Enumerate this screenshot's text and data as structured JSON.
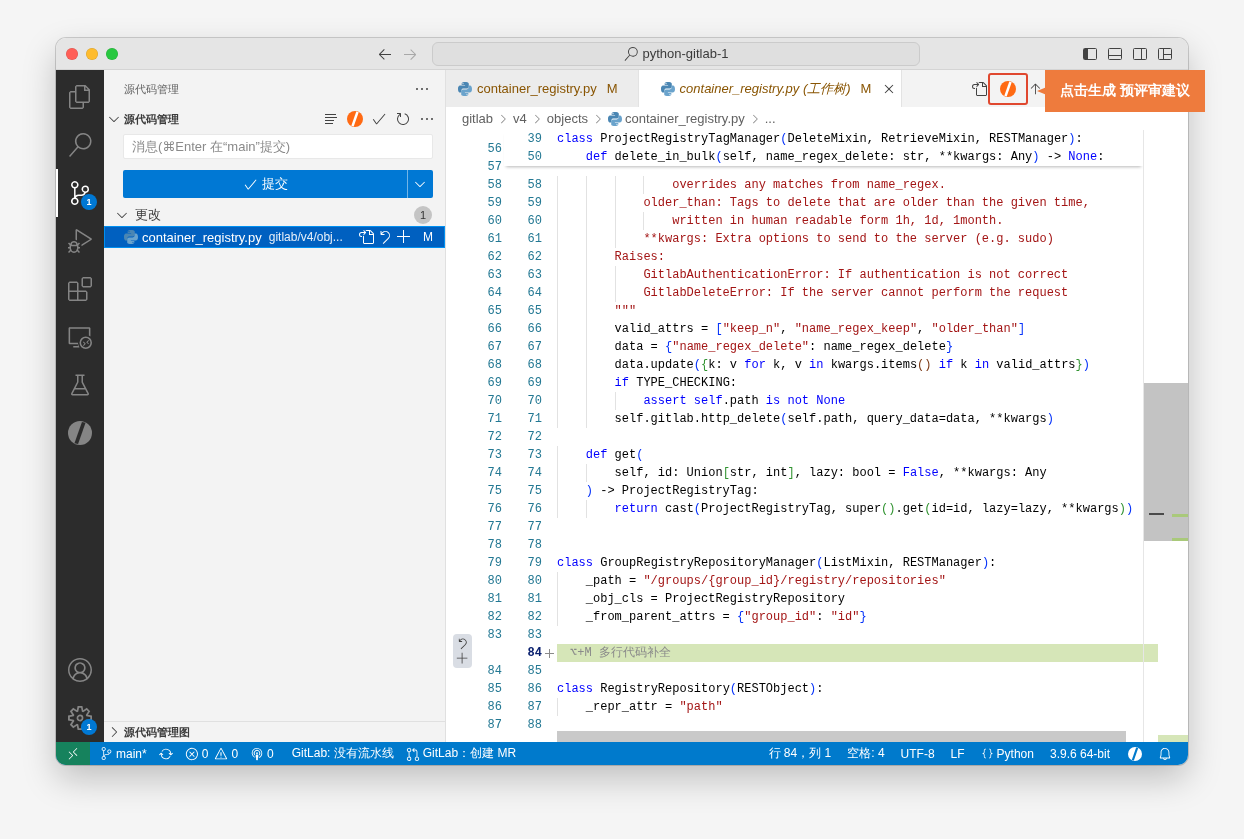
{
  "window": {
    "title": "python-gitlab-1",
    "can_go_back": true,
    "can_go_forward": false
  },
  "activity_bar": {
    "items": [
      {
        "kind": "explorer",
        "selected": false
      },
      {
        "kind": "search",
        "selected": false
      },
      {
        "kind": "source_control",
        "selected": true,
        "badge": "1"
      },
      {
        "kind": "run_debug",
        "selected": false
      },
      {
        "kind": "extensions",
        "selected": false
      },
      {
        "kind": "remote_explorer",
        "selected": false
      },
      {
        "kind": "testing",
        "selected": false
      },
      {
        "kind": "assistant",
        "selected": false
      }
    ],
    "bottom_items": [
      {
        "kind": "account"
      },
      {
        "kind": "settings",
        "badge": "1"
      }
    ]
  },
  "sidebar": {
    "title": "源代码管理",
    "section": {
      "title": "源代码管理",
      "expanded": true
    },
    "message_input": {
      "placeholder": "消息(⌘Enter 在“main”提交)"
    },
    "commit_button": {
      "label": "提交"
    },
    "changes": {
      "title": "更改",
      "expanded": true,
      "count": "1",
      "files": [
        {
          "name": "container_registry.py",
          "path": "gitlab/v4/obj...",
          "status": "M",
          "selected": true
        }
      ]
    },
    "graph_section": {
      "title": "源代码管理图",
      "expanded": false
    }
  },
  "tabs": [
    {
      "label": "container_registry.py",
      "status": "M",
      "selected": false,
      "preview": false
    },
    {
      "label": "container_registry.py (工作树)",
      "status": "M",
      "selected": true,
      "preview": true
    }
  ],
  "callout": {
    "text": "点击生成 预评审建议"
  },
  "breadcrumbs": [
    {
      "kind": "folder",
      "label": "gitlab"
    },
    {
      "kind": "folder",
      "label": "v4"
    },
    {
      "kind": "folder",
      "label": "objects"
    },
    {
      "kind": "file",
      "label": "container_registry.py"
    },
    {
      "kind": "symbol",
      "label": "..."
    }
  ],
  "editor": {
    "sticky_lines": [
      {
        "new": "39",
        "tokens": [
          {
            "kind": "keyword",
            "text": "class"
          },
          {
            "kind": "plain",
            "text": " ProjectRegistryTagManager"
          },
          {
            "kind": "bracket1",
            "text": "("
          },
          {
            "kind": "plain",
            "text": "DeleteMixin, RetrieveMixin, RESTManager"
          },
          {
            "kind": "bracket1",
            "text": ")"
          },
          {
            "kind": "plain",
            "text": ":"
          }
        ]
      },
      {
        "new": "50",
        "tokens": [
          {
            "kind": "keyword",
            "text": "    def"
          },
          {
            "kind": "plain",
            "text": " delete_in_bulk"
          },
          {
            "kind": "bracket1",
            "text": "("
          },
          {
            "kind": "plain",
            "text": "self, name_regex_delete: str, **kwargs: Any"
          },
          {
            "kind": "bracket1",
            "text": ")"
          },
          {
            "kind": "plain",
            "text": " -> "
          },
          {
            "kind": "keyword",
            "text": "None"
          },
          {
            "kind": "plain",
            "text": ":"
          }
        ]
      }
    ],
    "lines": [
      {
        "kind": "context",
        "old": "56",
        "current": false
      },
      {
        "kind": "context",
        "old": "57",
        "current": false
      },
      {
        "kind": "context",
        "old": "58",
        "new": "58",
        "current": false,
        "tokens": [
          {
            "kind": "string",
            "text": "                overrides any matches from name_regex."
          }
        ]
      },
      {
        "kind": "context",
        "old": "59",
        "new": "59",
        "current": false,
        "tokens": [
          {
            "kind": "string",
            "text": "            older_than: Tags to delete that are older than the given time,"
          }
        ]
      },
      {
        "kind": "context",
        "old": "60",
        "new": "60",
        "current": false,
        "tokens": [
          {
            "kind": "string",
            "text": "                written in human readable form 1h, 1d, 1month."
          }
        ]
      },
      {
        "kind": "context",
        "old": "61",
        "new": "61",
        "current": false,
        "tokens": [
          {
            "kind": "string",
            "text": "            **kwargs: Extra options to send to the server (e.g. sudo)"
          }
        ]
      },
      {
        "kind": "context",
        "old": "62",
        "new": "62",
        "current": false,
        "tokens": [
          {
            "kind": "string",
            "text": "        Raises:"
          }
        ]
      },
      {
        "kind": "context",
        "old": "63",
        "new": "63",
        "current": false,
        "tokens": [
          {
            "kind": "string",
            "text": "            GitlabAuthenticationError: If authentication is not correct"
          }
        ]
      },
      {
        "kind": "context",
        "old": "64",
        "new": "64",
        "current": false,
        "tokens": [
          {
            "kind": "string",
            "text": "            GitlabDeleteError: If the server cannot perform the request"
          }
        ]
      },
      {
        "kind": "context",
        "old": "65",
        "new": "65",
        "current": false,
        "tokens": [
          {
            "kind": "string",
            "text": "        \"\"\""
          }
        ]
      },
      {
        "kind": "context",
        "old": "66",
        "new": "66",
        "current": false,
        "tokens": [
          {
            "kind": "plain",
            "text": "        valid_attrs = "
          },
          {
            "kind": "bracket1",
            "text": "["
          },
          {
            "kind": "string",
            "text": "\"keep_n\""
          },
          {
            "kind": "plain",
            "text": ", "
          },
          {
            "kind": "string",
            "text": "\"name_regex_keep\""
          },
          {
            "kind": "plain",
            "text": ", "
          },
          {
            "kind": "string",
            "text": "\"older_than\""
          },
          {
            "kind": "bracket1",
            "text": "]"
          }
        ]
      },
      {
        "kind": "context",
        "old": "67",
        "new": "67",
        "current": false,
        "tokens": [
          {
            "kind": "plain",
            "text": "        data = "
          },
          {
            "kind": "bracket1",
            "text": "{"
          },
          {
            "kind": "string",
            "text": "\"name_regex_delete\""
          },
          {
            "kind": "plain",
            "text": ": name_regex_delete"
          },
          {
            "kind": "bracket1",
            "text": "}"
          }
        ]
      },
      {
        "kind": "context",
        "old": "68",
        "new": "68",
        "current": false,
        "tokens": [
          {
            "kind": "plain",
            "text": "        data.update"
          },
          {
            "kind": "bracket1",
            "text": "("
          },
          {
            "kind": "bracket2",
            "text": "{"
          },
          {
            "kind": "plain",
            "text": "k: v "
          },
          {
            "kind": "keyword",
            "text": "for"
          },
          {
            "kind": "plain",
            "text": " k, v "
          },
          {
            "kind": "keyword",
            "text": "in"
          },
          {
            "kind": "plain",
            "text": " kwargs.items"
          },
          {
            "kind": "bracket3",
            "text": "()"
          },
          {
            "kind": "keyword",
            "text": " if"
          },
          {
            "kind": "plain",
            "text": " k "
          },
          {
            "kind": "keyword",
            "text": "in"
          },
          {
            "kind": "plain",
            "text": " valid_attrs"
          },
          {
            "kind": "bracket2",
            "text": "}"
          },
          {
            "kind": "bracket1",
            "text": ")"
          }
        ]
      },
      {
        "kind": "context",
        "old": "69",
        "new": "69",
        "current": false,
        "tokens": [
          {
            "kind": "keyword",
            "text": "        if"
          },
          {
            "kind": "plain",
            "text": " TYPE_CHECKING:"
          }
        ]
      },
      {
        "kind": "context",
        "old": "70",
        "new": "70",
        "current": false,
        "tokens": [
          {
            "kind": "keyword",
            "text": "            assert"
          },
          {
            "kind": "keyword",
            "text": " self"
          },
          {
            "kind": "plain",
            "text": ".path "
          },
          {
            "kind": "keyword",
            "text": "is not"
          },
          {
            "kind": "keyword",
            "text": " None"
          }
        ]
      },
      {
        "kind": "context",
        "old": "71",
        "new": "71",
        "current": false,
        "tokens": [
          {
            "kind": "plain",
            "text": "        self.gitlab.http_delete"
          },
          {
            "kind": "bracket1",
            "text": "("
          },
          {
            "kind": "plain",
            "text": "self.path, query_data=data, **kwargs"
          },
          {
            "kind": "bracket1",
            "text": ")"
          }
        ]
      },
      {
        "kind": "context",
        "old": "72",
        "new": "72",
        "current": false
      },
      {
        "kind": "context",
        "old": "73",
        "new": "73",
        "current": false,
        "tokens": [
          {
            "kind": "keyword",
            "text": "    def"
          },
          {
            "kind": "plain",
            "text": " get"
          },
          {
            "kind": "bracket1",
            "text": "("
          }
        ]
      },
      {
        "kind": "context",
        "old": "74",
        "new": "74",
        "current": false,
        "tokens": [
          {
            "kind": "plain",
            "text": "        self, id: Union"
          },
          {
            "kind": "bracket2",
            "text": "["
          },
          {
            "kind": "plain",
            "text": "str, int"
          },
          {
            "kind": "bracket2",
            "text": "]"
          },
          {
            "kind": "plain",
            "text": ", lazy: bool = "
          },
          {
            "kind": "keyword",
            "text": "False"
          },
          {
            "kind": "plain",
            "text": ", **kwargs: Any"
          }
        ]
      },
      {
        "kind": "context",
        "old": "75",
        "new": "75",
        "current": false,
        "tokens": [
          {
            "kind": "bracket1",
            "text": "    )"
          },
          {
            "kind": "plain",
            "text": " -> ProjectRegistryTag:"
          }
        ]
      },
      {
        "kind": "context",
        "old": "76",
        "new": "76",
        "current": false,
        "tokens": [
          {
            "kind": "keyword",
            "text": "        return"
          },
          {
            "kind": "plain",
            "text": " cast"
          },
          {
            "kind": "bracket1",
            "text": "("
          },
          {
            "kind": "plain",
            "text": "ProjectRegistryTag, super"
          },
          {
            "kind": "bracket2",
            "text": "()"
          },
          {
            "kind": "plain",
            "text": ".get"
          },
          {
            "kind": "bracket2",
            "text": "("
          },
          {
            "kind": "plain",
            "text": "id=id, lazy=lazy, **kwargs"
          },
          {
            "kind": "bracket2",
            "text": ")"
          },
          {
            "kind": "bracket1",
            "text": ")"
          }
        ]
      },
      {
        "kind": "context",
        "old": "77",
        "new": "77",
        "current": false
      },
      {
        "kind": "context",
        "old": "78",
        "new": "78",
        "current": false
      },
      {
        "kind": "context",
        "old": "79",
        "new": "79",
        "current": false,
        "tokens": [
          {
            "kind": "keyword",
            "text": "class"
          },
          {
            "kind": "plain",
            "text": " GroupRegistryRepositoryManager"
          },
          {
            "kind": "bracket1",
            "text": "("
          },
          {
            "kind": "plain",
            "text": "ListMixin, RESTManager"
          },
          {
            "kind": "bracket1",
            "text": ")"
          },
          {
            "kind": "plain",
            "text": ":"
          }
        ]
      },
      {
        "kind": "context",
        "old": "80",
        "new": "80",
        "current": false,
        "tokens": [
          {
            "kind": "plain",
            "text": "    _path = "
          },
          {
            "kind": "string",
            "text": "\"/groups/{group_id}/registry/repositories\""
          }
        ]
      },
      {
        "kind": "context",
        "old": "81",
        "new": "81",
        "current": false,
        "tokens": [
          {
            "kind": "plain",
            "text": "    _obj_cls = ProjectRegistryRepository"
          }
        ]
      },
      {
        "kind": "context",
        "old": "82",
        "new": "82",
        "current": false,
        "tokens": [
          {
            "kind": "plain",
            "text": "    _from_parent_attrs = "
          },
          {
            "kind": "bracket1",
            "text": "{"
          },
          {
            "kind": "string",
            "text": "\"group_id\""
          },
          {
            "kind": "plain",
            "text": ": "
          },
          {
            "kind": "string",
            "text": "\"id\""
          },
          {
            "kind": "bracket1",
            "text": "}"
          }
        ]
      },
      {
        "kind": "context",
        "old": "83",
        "new": "83",
        "current": false
      },
      {
        "kind": "added",
        "new": "84",
        "current": true,
        "tokens": [
          {
            "kind": "hint",
            "text": "⌥+M 多行代码补全"
          }
        ]
      },
      {
        "kind": "context",
        "old": "84",
        "new": "85",
        "current": false
      },
      {
        "kind": "context",
        "old": "85",
        "new": "86",
        "current": false,
        "tokens": [
          {
            "kind": "keyword",
            "text": "class"
          },
          {
            "kind": "plain",
            "text": " RegistryRepository"
          },
          {
            "kind": "bracket1",
            "text": "("
          },
          {
            "kind": "plain",
            "text": "RESTObject"
          },
          {
            "kind": "bracket1",
            "text": ")"
          },
          {
            "kind": "plain",
            "text": ":"
          }
        ]
      },
      {
        "kind": "context",
        "old": "86",
        "new": "87",
        "current": false,
        "tokens": [
          {
            "kind": "plain",
            "text": "    _repr_attr = "
          },
          {
            "kind": "string",
            "text": "\"path\""
          }
        ]
      },
      {
        "kind": "context",
        "old": "87",
        "new": "88",
        "current": false
      },
      {
        "kind": "folded"
      }
    ]
  },
  "status_bar": {
    "left": [
      {
        "kind": "remote"
      },
      {
        "kind": "branch",
        "text": "main*"
      },
      {
        "kind": "sync"
      },
      {
        "kind": "problems",
        "errors": "0",
        "warnings": "0"
      },
      {
        "kind": "ports",
        "text": "0"
      },
      {
        "kind": "pipeline",
        "text": "GitLab: 没有流水线"
      },
      {
        "kind": "merge_request",
        "text": "GitLab：创建 MR"
      }
    ],
    "right": [
      {
        "kind": "plain",
        "text": "行 84，列 1"
      },
      {
        "kind": "plain",
        "text": "空格: 4"
      },
      {
        "kind": "plain",
        "text": "UTF-8"
      },
      {
        "kind": "plain",
        "text": "LF"
      },
      {
        "kind": "language",
        "text": "Python"
      },
      {
        "kind": "plain",
        "text": "3.9.6 64-bit"
      },
      {
        "kind": "assistant"
      },
      {
        "kind": "notifications"
      }
    ]
  }
}
